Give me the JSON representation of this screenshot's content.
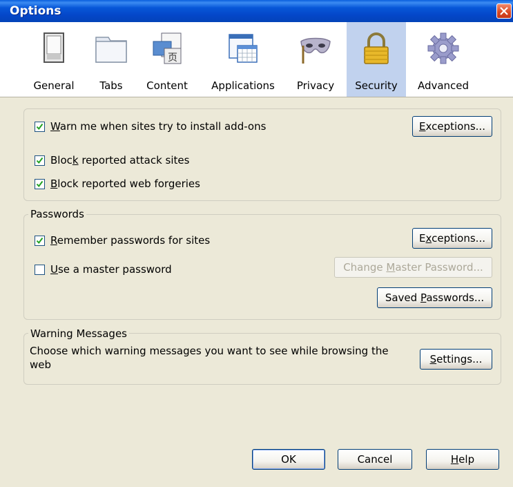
{
  "window": {
    "title": "Options"
  },
  "tabs": [
    {
      "label": "General",
      "icon": "window-switch-icon"
    },
    {
      "label": "Tabs",
      "icon": "tabs-folder-icon"
    },
    {
      "label": "Content",
      "icon": "content-image-icon"
    },
    {
      "label": "Applications",
      "icon": "applications-calendar-icon"
    },
    {
      "label": "Privacy",
      "icon": "privacy-mask-icon"
    },
    {
      "label": "Security",
      "icon": "security-lock-icon",
      "selected": true
    },
    {
      "label": "Advanced",
      "icon": "advanced-gear-icon"
    }
  ],
  "addons": {
    "warn": {
      "pre": "",
      "key": "W",
      "post": "arn me when sites try to install add-ons",
      "checked": true
    },
    "exceptions": {
      "pre": "",
      "key": "E",
      "post": "xceptions..."
    },
    "block_attack": {
      "pre": "Bloc",
      "key": "k",
      "post": " reported attack sites",
      "checked": true
    },
    "block_forgeries": {
      "pre": "",
      "key": "B",
      "post": "lock reported web forgeries",
      "checked": true
    }
  },
  "passwords": {
    "legend": "Passwords",
    "remember": {
      "pre": "",
      "key": "R",
      "post": "emember passwords for sites",
      "checked": true
    },
    "exceptions": {
      "pre": "E",
      "key": "x",
      "post": "ceptions..."
    },
    "master": {
      "pre": "",
      "key": "U",
      "post": "se a master password",
      "checked": false
    },
    "change_master": {
      "pre": "Change ",
      "key": "M",
      "post": "aster Password..."
    },
    "saved": {
      "pre": "Saved ",
      "key": "P",
      "post": "asswords..."
    }
  },
  "warnings": {
    "legend": "Warning Messages",
    "description": "Choose which warning messages you want to see while browsing the web",
    "settings": {
      "pre": "",
      "key": "S",
      "post": "ettings..."
    }
  },
  "footer": {
    "ok": "OK",
    "cancel": "Cancel",
    "help": {
      "pre": "",
      "key": "H",
      "post": "elp"
    }
  }
}
